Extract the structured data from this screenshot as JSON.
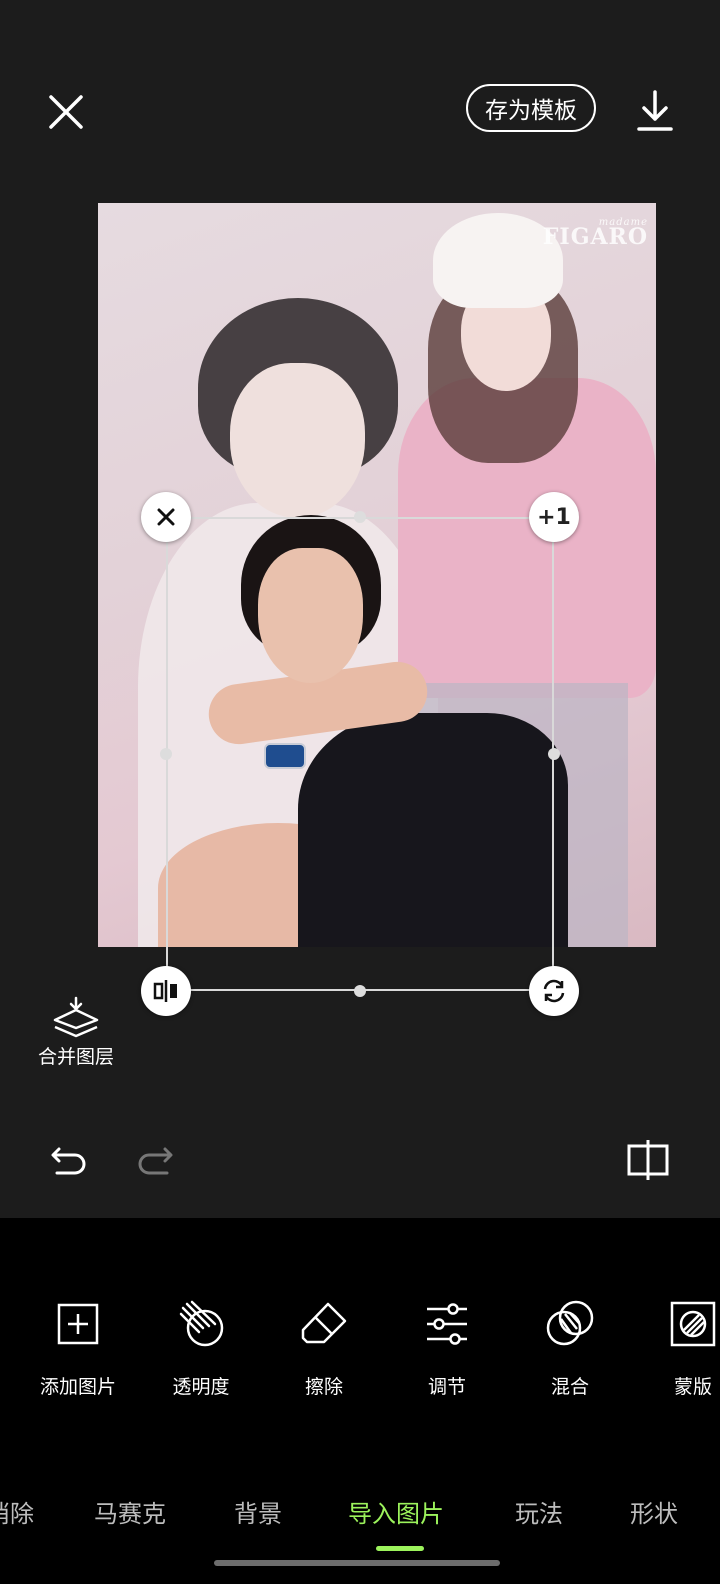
{
  "header": {
    "save_template_label": "存为模板"
  },
  "canvas": {
    "watermark_small": "madame",
    "watermark": "FIGARO"
  },
  "selection": {
    "duplicate_label": "+1"
  },
  "merge_layers_label": "合并图层",
  "tools": [
    {
      "label": "添加图片",
      "icon": "add-image-icon"
    },
    {
      "label": "透明度",
      "icon": "opacity-icon"
    },
    {
      "label": "擦除",
      "icon": "eraser-icon"
    },
    {
      "label": "调节",
      "icon": "adjust-sliders-icon"
    },
    {
      "label": "混合",
      "icon": "blend-icon"
    },
    {
      "label": "蒙版",
      "icon": "mask-icon"
    }
  ],
  "tabs": [
    {
      "label": "消除",
      "active": false
    },
    {
      "label": "马赛克",
      "active": false
    },
    {
      "label": "背景",
      "active": false
    },
    {
      "label": "导入图片",
      "active": true
    },
    {
      "label": "玩法",
      "active": false
    },
    {
      "label": "形状",
      "active": false
    }
  ],
  "colors": {
    "accent": "#9cf35c",
    "background": "#1c1c1c",
    "panel": "#000000"
  }
}
